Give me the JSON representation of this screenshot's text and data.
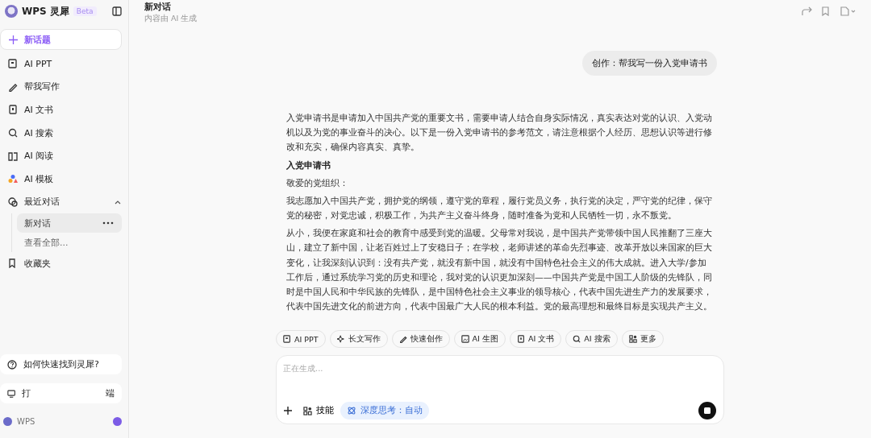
{
  "sidebar": {
    "app_name": "WPS 灵犀",
    "badge": "Beta",
    "new_topic": "新话题",
    "items": [
      {
        "label": "AI PPT",
        "kind": "ppt"
      },
      {
        "label": "帮我写作",
        "kind": "pen"
      },
      {
        "label": "AI 文书",
        "kind": "doc"
      },
      {
        "label": "AI 搜索",
        "kind": "search"
      },
      {
        "label": "AI 阅读",
        "kind": "book"
      },
      {
        "label": "AI 模板",
        "kind": "shapes"
      }
    ],
    "recent": {
      "label": "最近对话",
      "expanded": true,
      "items": [
        {
          "label": "新对话",
          "selected": true
        },
        {
          "label": "查看全部...",
          "selected": false
        }
      ]
    },
    "favorites": "收藏夹",
    "help": "如何快速找到灵犀?",
    "desktop": {
      "label_start": "打",
      "label_end": "端"
    },
    "footer": "WPS"
  },
  "header": {
    "title": "新对话",
    "subtitle": "内容由 AI 生成"
  },
  "chat": {
    "user_message": "创作：帮我写一份入党申请书",
    "paragraphs": [
      {
        "kind": "text",
        "text": "入党申请书是申请加入中国共产党的重要文书，需要申请人结合自身实际情况，真实表达对党的认识、入党动机以及为党的事业奋斗的决心。以下是一份入党申请书的参考范文，请注意根据个人经历、思想认识等进行修改和充实，确保内容真实、真挚。"
      },
      {
        "kind": "heading",
        "text": "入党申请书"
      },
      {
        "kind": "text",
        "text": "敬爱的党组织："
      },
      {
        "kind": "text",
        "text": "我志愿加入中国共产党，拥护党的纲领，遵守党的章程，履行党员义务，执行党的决定，严守党的纪律，保守党的秘密，对党忠诚，积极工作，为共产主义奋斗终身，随时准备为党和人民牺牲一切，永不叛党。"
      },
      {
        "kind": "text",
        "text": "从小，我便在家庭和社会的教育中感受到党的温暖。父母常对我说，是中国共产党带领中国人民推翻了三座大山，建立了新中国，让老百姓过上了安稳日子；在学校，老师讲述的革命先烈事迹、改革开放以来国家的巨大变化，让我深刻认识到：没有共产党，就没有新中国，就没有中国特色社会主义的伟大成就。进入大学/参加工作后，通过系统学习党的历史和理论，我对党的认识更加深刻——中国共产党是中国工人阶级的先锋队，同时是中国人民和中华民族的先锋队，是中国特色社会主义事业的领导核心，代表中国先进生产力的发展要求，代表中国先进文化的前进方向，代表中国最广大人民的根本利益。党的最高理想和最终目标是实现共产主义。"
      }
    ]
  },
  "chips": [
    {
      "label": "AI PPT",
      "kind": "ppt"
    },
    {
      "label": "长文写作",
      "kind": "sparkle"
    },
    {
      "label": "快速创作",
      "kind": "pen"
    },
    {
      "label": "AI 生图",
      "kind": "image"
    },
    {
      "label": "AI 文书",
      "kind": "doc"
    },
    {
      "label": "AI 搜索",
      "kind": "search"
    },
    {
      "label": "更多",
      "kind": "grid"
    }
  ],
  "composer": {
    "placeholder": "正在生成...",
    "skills": "技能",
    "deep_think": "深度思考：自动"
  }
}
